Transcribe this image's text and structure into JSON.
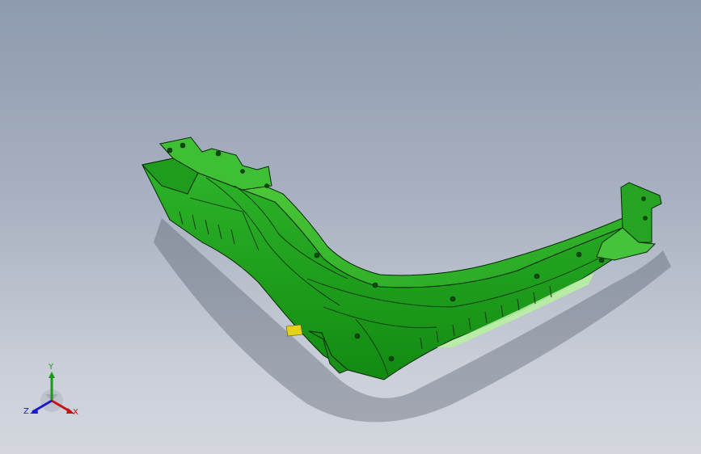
{
  "viewport": {
    "background_top": "#8e9aae",
    "background_bottom": "#d4d7de",
    "part_color": "#1e9d1e",
    "part_highlight": "#5fd84a",
    "edge_color": "#062806",
    "accent_yellow": "#e3d21a"
  },
  "triad": {
    "x_label": "X",
    "y_label": "Y",
    "z_label": "Z",
    "x_color": "#c41414",
    "y_color": "#1a9a1a",
    "z_color": "#1a1ad0",
    "icon": "coordinate-triad-icon"
  }
}
